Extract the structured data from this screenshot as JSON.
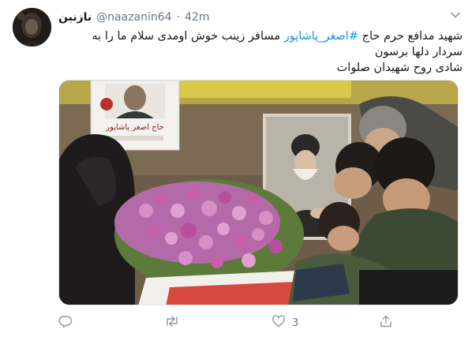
{
  "tweet": {
    "display_name": "نازنین",
    "handle": "@naazanin64",
    "separator": "·",
    "time": "42m",
    "text": {
      "line1_before": "شهید مدافع حرم حاج ",
      "hashtag": "#اصغر_پاشاپور",
      "line1_after": " مسافر زینب خوش اومدی سلام ما را به",
      "line2": "سردار دلها برسون",
      "line3": "شادی روح شهیدان صلوات"
    },
    "media": {
      "portrait_caption": "حاج اصغر پاشاپور"
    },
    "actions": {
      "reply_count": "",
      "retweet_count": "",
      "like_count": "3",
      "share_count": ""
    }
  },
  "icons": {
    "reply": "reply-icon",
    "retweet": "retweet-icon",
    "like": "heart-icon",
    "share": "share-icon",
    "more": "chevron-down-icon"
  },
  "colors": {
    "accent": "#1b95e0",
    "secondary_text": "#657786",
    "icon": "#8899a6"
  }
}
